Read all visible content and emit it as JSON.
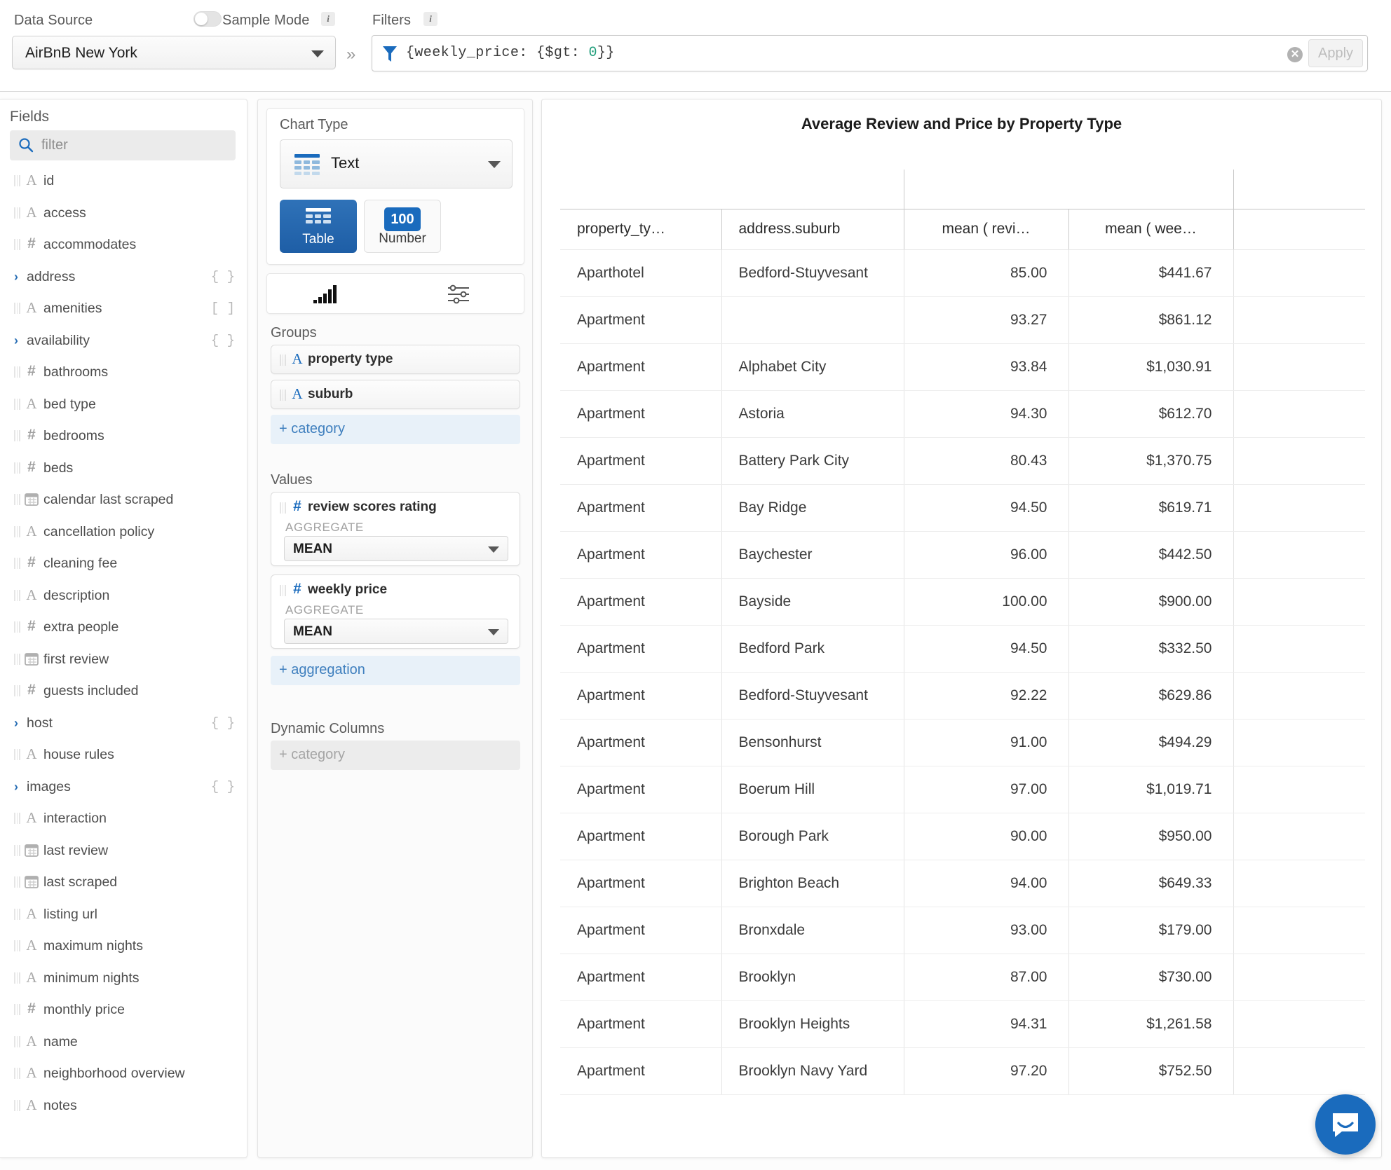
{
  "topbar": {
    "data_source_label": "Data Source",
    "data_source_value": "AirBnB New York",
    "sample_mode_label": "Sample Mode",
    "sample_mode_on": false,
    "info_glyph": "i",
    "filters_label": "Filters",
    "filter_expression_prefix": "{weekly_price: {$gt: ",
    "filter_expression_number": "0",
    "filter_expression_suffix": "}}",
    "clear_glyph": "✕",
    "apply_label": "Apply",
    "expand_glyph": "»"
  },
  "fields": {
    "title": "Fields",
    "search_placeholder": "filter",
    "items": [
      {
        "label": "id",
        "icon": "string-icon",
        "kind": "leaf",
        "type": ""
      },
      {
        "label": "access",
        "icon": "string-icon",
        "kind": "leaf",
        "type": ""
      },
      {
        "label": "accommodates",
        "icon": "number-icon",
        "kind": "leaf",
        "type": ""
      },
      {
        "label": "address",
        "icon": "expand-icon",
        "kind": "object",
        "type": "{ }"
      },
      {
        "label": "amenities",
        "icon": "string-icon",
        "kind": "leaf",
        "type": "[ ]"
      },
      {
        "label": "availability",
        "icon": "expand-icon",
        "kind": "object",
        "type": "{ }"
      },
      {
        "label": "bathrooms",
        "icon": "number-icon",
        "kind": "leaf",
        "type": ""
      },
      {
        "label": "bed  type",
        "icon": "string-icon",
        "kind": "leaf",
        "type": ""
      },
      {
        "label": "bedrooms",
        "icon": "number-icon",
        "kind": "leaf",
        "type": ""
      },
      {
        "label": "beds",
        "icon": "number-icon",
        "kind": "leaf",
        "type": ""
      },
      {
        "label": "calendar  last  scraped",
        "icon": "calendar-icon",
        "kind": "leaf",
        "type": ""
      },
      {
        "label": "cancellation  policy",
        "icon": "string-icon",
        "kind": "leaf",
        "type": ""
      },
      {
        "label": "cleaning  fee",
        "icon": "number-icon",
        "kind": "leaf",
        "type": ""
      },
      {
        "label": "description",
        "icon": "string-icon",
        "kind": "leaf",
        "type": ""
      },
      {
        "label": "extra  people",
        "icon": "number-icon",
        "kind": "leaf",
        "type": ""
      },
      {
        "label": "first  review",
        "icon": "calendar-icon",
        "kind": "leaf",
        "type": ""
      },
      {
        "label": "guests  included",
        "icon": "number-icon",
        "kind": "leaf",
        "type": ""
      },
      {
        "label": "host",
        "icon": "expand-icon",
        "kind": "object",
        "type": "{ }"
      },
      {
        "label": "house  rules",
        "icon": "string-icon",
        "kind": "leaf",
        "type": ""
      },
      {
        "label": "images",
        "icon": "expand-icon",
        "kind": "object",
        "type": "{ }"
      },
      {
        "label": "interaction",
        "icon": "string-icon",
        "kind": "leaf",
        "type": ""
      },
      {
        "label": "last  review",
        "icon": "calendar-icon",
        "kind": "leaf",
        "type": ""
      },
      {
        "label": "last  scraped",
        "icon": "calendar-icon",
        "kind": "leaf",
        "type": ""
      },
      {
        "label": "listing  url",
        "icon": "string-icon",
        "kind": "leaf",
        "type": ""
      },
      {
        "label": "maximum  nights",
        "icon": "string-icon",
        "kind": "leaf",
        "type": ""
      },
      {
        "label": "minimum  nights",
        "icon": "string-icon",
        "kind": "leaf",
        "type": ""
      },
      {
        "label": "monthly  price",
        "icon": "number-icon",
        "kind": "leaf",
        "type": ""
      },
      {
        "label": "name",
        "icon": "string-icon",
        "kind": "leaf",
        "type": ""
      },
      {
        "label": "neighborhood  overview",
        "icon": "string-icon",
        "kind": "leaf",
        "type": ""
      },
      {
        "label": "notes",
        "icon": "string-icon",
        "kind": "leaf",
        "type": ""
      }
    ]
  },
  "config": {
    "chart_type_title": "Chart Type",
    "chart_type_value": "Text",
    "type_buttons": [
      {
        "label": "Table",
        "selected": true
      },
      {
        "label": "Number",
        "badge": "100",
        "selected": false
      }
    ],
    "groups_label": "Groups",
    "groups": [
      {
        "label": "property  type",
        "icon": "string-icon"
      },
      {
        "label": "suburb",
        "icon": "string-icon"
      }
    ],
    "add_category_label": "+ category",
    "values_label": "Values",
    "values": [
      {
        "label": "review  scores  rating",
        "icon": "number-icon",
        "aggregate_label": "AGGREGATE",
        "aggregate_value": "MEAN"
      },
      {
        "label": "weekly  price",
        "icon": "number-icon",
        "aggregate_label": "AGGREGATE",
        "aggregate_value": "MEAN"
      }
    ],
    "add_aggregation_label": "+ aggregation",
    "dynamic_columns_label": "Dynamic Columns",
    "dynamic_add_label": "+ category"
  },
  "chart_data": {
    "type": "table",
    "title": "Average Review and Price by Property Type",
    "columns": [
      "property_ty…",
      "address.suburb",
      "mean ( revi…",
      "mean ( wee…"
    ],
    "rows": [
      [
        "Aparthotel",
        "Bedford-Stuyvesant",
        "85.00",
        "$441.67"
      ],
      [
        "Apartment",
        "",
        "93.27",
        "$861.12"
      ],
      [
        "Apartment",
        "Alphabet City",
        "93.84",
        "$1,030.91"
      ],
      [
        "Apartment",
        "Astoria",
        "94.30",
        "$612.70"
      ],
      [
        "Apartment",
        "Battery Park City",
        "80.43",
        "$1,370.75"
      ],
      [
        "Apartment",
        "Bay Ridge",
        "94.50",
        "$619.71"
      ],
      [
        "Apartment",
        "Baychester",
        "96.00",
        "$442.50"
      ],
      [
        "Apartment",
        "Bayside",
        "100.00",
        "$900.00"
      ],
      [
        "Apartment",
        "Bedford Park",
        "94.50",
        "$332.50"
      ],
      [
        "Apartment",
        "Bedford-Stuyvesant",
        "92.22",
        "$629.86"
      ],
      [
        "Apartment",
        "Bensonhurst",
        "91.00",
        "$494.29"
      ],
      [
        "Apartment",
        "Boerum Hill",
        "97.00",
        "$1,019.71"
      ],
      [
        "Apartment",
        "Borough Park",
        "90.00",
        "$950.00"
      ],
      [
        "Apartment",
        "Brighton Beach",
        "94.00",
        "$649.33"
      ],
      [
        "Apartment",
        "Bronxdale",
        "93.00",
        "$179.00"
      ],
      [
        "Apartment",
        "Brooklyn",
        "87.00",
        "$730.00"
      ],
      [
        "Apartment",
        "Brooklyn Heights",
        "94.31",
        "$1,261.58"
      ],
      [
        "Apartment",
        "Brooklyn Navy Yard",
        "97.20",
        "$752.50"
      ]
    ]
  },
  "colors": {
    "accent_blue": "#1a6bbd",
    "table_button_blue": "#2563a8",
    "add_button_blue": "#3f7fbe",
    "filter_number_green": "#1f9d7a"
  },
  "chat": {
    "icon": "chat-bubble-icon"
  }
}
